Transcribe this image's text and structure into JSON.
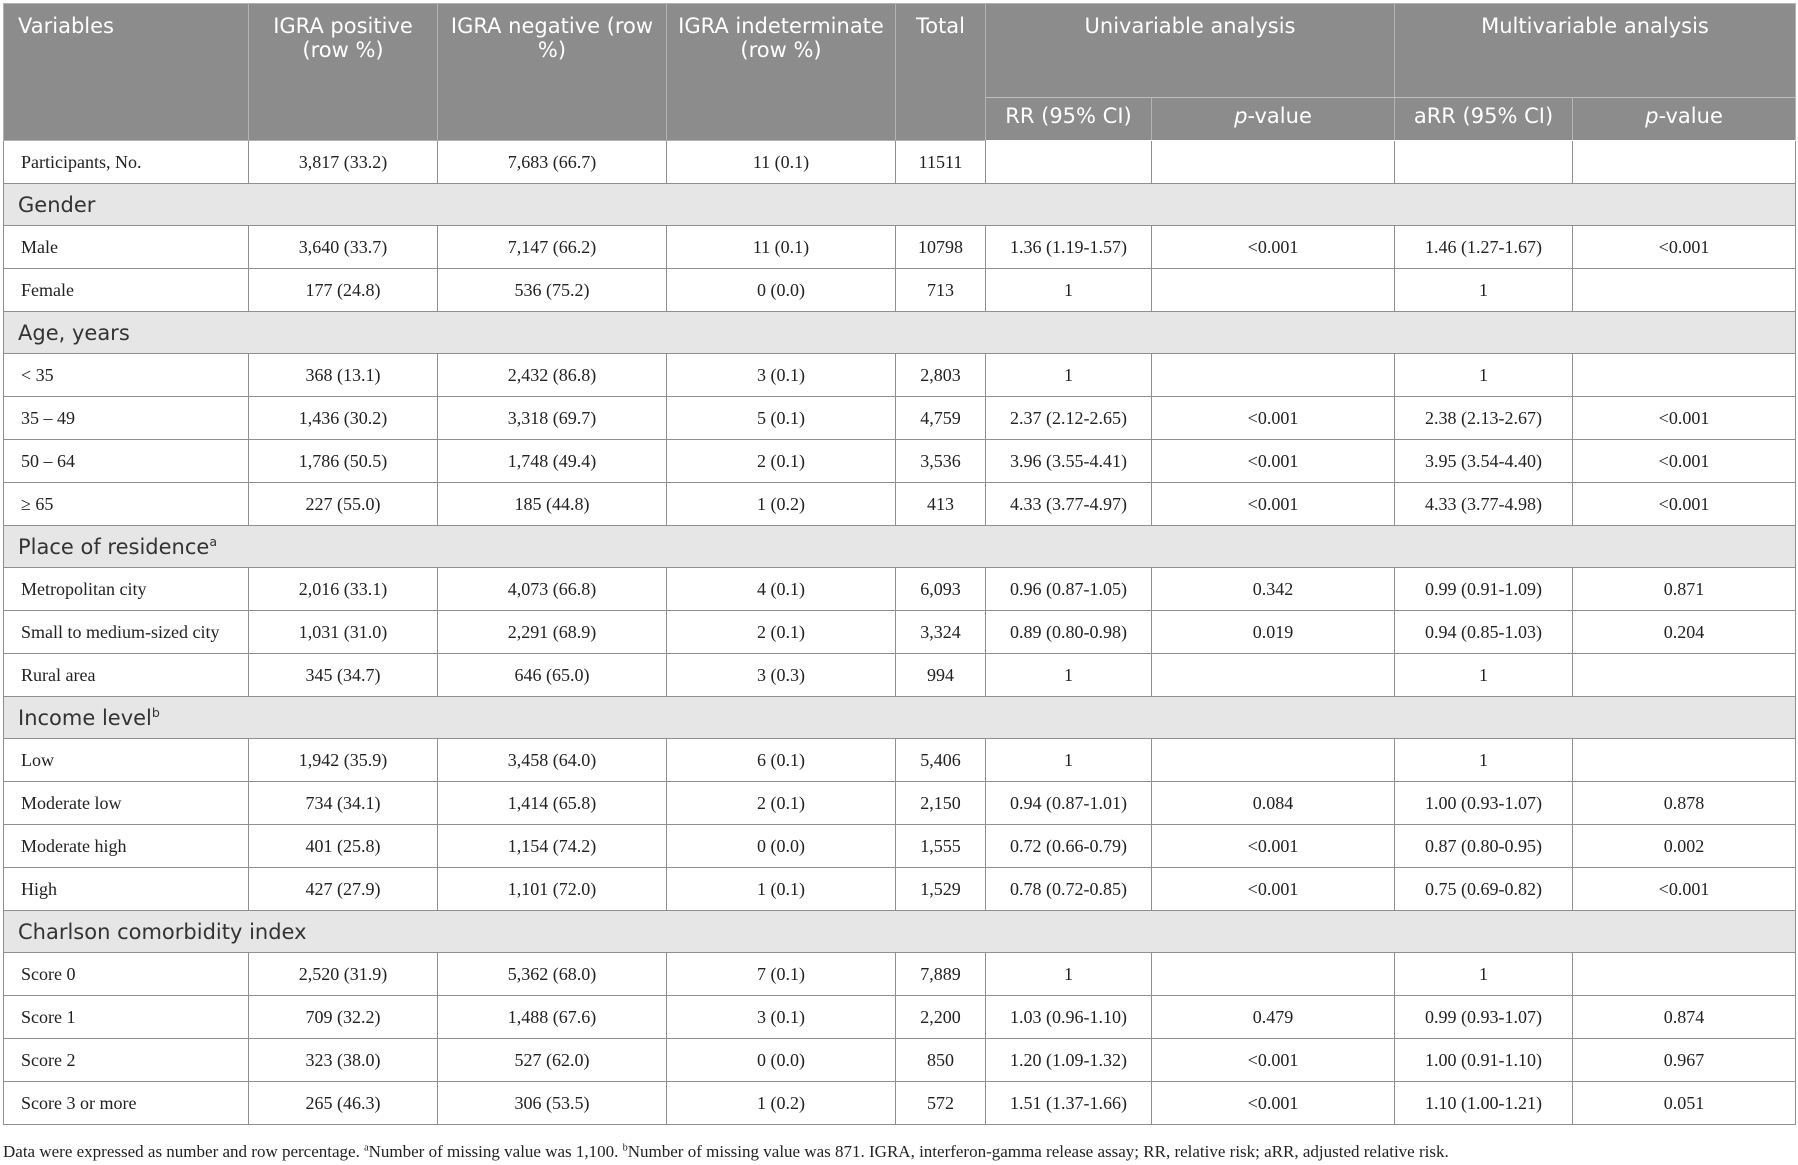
{
  "headers": {
    "variables": "Variables",
    "igra_positive": "IGRA positive (row %)",
    "igra_negative": "IGRA negative (row %)",
    "igra_indeterminate": "IGRA indeterminate (row %)",
    "total": "Total",
    "univariable": "Univariable analysis",
    "multivariable": "Multivariable analysis",
    "rr": "RR (95% CI)",
    "pvalue_p": "p",
    "pvalue_rest": "-value",
    "arr": "aRR (95% CI)"
  },
  "participants": {
    "label": "Participants, No.",
    "pos": "3,817 (33.2)",
    "neg": "7,683 (66.7)",
    "ind": "11 (0.1)",
    "total": "11511"
  },
  "sections": [
    {
      "title": "Gender",
      "sup": "",
      "rows": [
        {
          "label": "Male",
          "pos": "3,640 (33.7)",
          "neg": "7,147 (66.2)",
          "ind": "11 (0.1)",
          "total": "10798",
          "rr": "1.36 (1.19-1.57)",
          "p1": "<0.001",
          "arr": "1.46 (1.27-1.67)",
          "p2": "<0.001"
        },
        {
          "label": "Female",
          "pos": "177 (24.8)",
          "neg": "536 (75.2)",
          "ind": "0 (0.0)",
          "total": "713",
          "rr": "1",
          "p1": "",
          "arr": "1",
          "p2": ""
        }
      ]
    },
    {
      "title": "Age, years",
      "sup": "",
      "rows": [
        {
          "label": "< 35",
          "pos": "368 (13.1)",
          "neg": "2,432 (86.8)",
          "ind": "3 (0.1)",
          "total": "2,803",
          "rr": "1",
          "p1": "",
          "arr": "1",
          "p2": ""
        },
        {
          "label": "35 – 49",
          "pos": "1,436 (30.2)",
          "neg": "3,318 (69.7)",
          "ind": "5 (0.1)",
          "total": "4,759",
          "rr": "2.37 (2.12-2.65)",
          "p1": "<0.001",
          "arr": "2.38 (2.13-2.67)",
          "p2": "<0.001"
        },
        {
          "label": "50 – 64",
          "pos": "1,786 (50.5)",
          "neg": "1,748 (49.4)",
          "ind": "2 (0.1)",
          "total": "3,536",
          "rr": "3.96 (3.55-4.41)",
          "p1": "<0.001",
          "arr": "3.95 (3.54-4.40)",
          "p2": "<0.001"
        },
        {
          "label": "≥ 65",
          "pos": "227 (55.0)",
          "neg": "185 (44.8)",
          "ind": "1 (0.2)",
          "total": "413",
          "rr": "4.33 (3.77-4.97)",
          "p1": "<0.001",
          "arr": "4.33 (3.77-4.98)",
          "p2": "<0.001"
        }
      ]
    },
    {
      "title": "Place of residence",
      "sup": "a",
      "rows": [
        {
          "label": "Metropolitan city",
          "pos": "2,016 (33.1)",
          "neg": "4,073 (66.8)",
          "ind": "4 (0.1)",
          "total": "6,093",
          "rr": "0.96 (0.87-1.05)",
          "p1": "0.342",
          "arr": "0.99 (0.91-1.09)",
          "p2": "0.871"
        },
        {
          "label": "Small to medium-sized city",
          "pos": "1,031 (31.0)",
          "neg": "2,291 (68.9)",
          "ind": "2 (0.1)",
          "total": "3,324",
          "rr": "0.89 (0.80-0.98)",
          "p1": "0.019",
          "arr": "0.94 (0.85-1.03)",
          "p2": "0.204"
        },
        {
          "label": "Rural area",
          "pos": "345 (34.7)",
          "neg": "646 (65.0)",
          "ind": "3 (0.3)",
          "total": "994",
          "rr": "1",
          "p1": "",
          "arr": "1",
          "p2": ""
        }
      ]
    },
    {
      "title": "Income level",
      "sup": "b",
      "rows": [
        {
          "label": "Low",
          "pos": "1,942 (35.9)",
          "neg": "3,458 (64.0)",
          "ind": "6 (0.1)",
          "total": "5,406",
          "rr": "1",
          "p1": "",
          "arr": "1",
          "p2": ""
        },
        {
          "label": "Moderate low",
          "pos": "734 (34.1)",
          "neg": "1,414 (65.8)",
          "ind": "2 (0.1)",
          "total": "2,150",
          "rr": "0.94 (0.87-1.01)",
          "p1": "0.084",
          "arr": "1.00 (0.93-1.07)",
          "p2": "0.878"
        },
        {
          "label": "Moderate high",
          "pos": "401 (25.8)",
          "neg": "1,154 (74.2)",
          "ind": "0 (0.0)",
          "total": "1,555",
          "rr": "0.72 (0.66-0.79)",
          "p1": "<0.001",
          "arr": "0.87 (0.80-0.95)",
          "p2": "0.002"
        },
        {
          "label": "High",
          "pos": "427 (27.9)",
          "neg": "1,101 (72.0)",
          "ind": "1 (0.1)",
          "total": "1,529",
          "rr": "0.78 (0.72-0.85)",
          "p1": "<0.001",
          "arr": "0.75 (0.69-0.82)",
          "p2": "<0.001"
        }
      ]
    },
    {
      "title": "Charlson comorbidity index",
      "sup": "",
      "rows": [
        {
          "label": "Score 0",
          "pos": "2,520 (31.9)",
          "neg": "5,362 (68.0)",
          "ind": "7 (0.1)",
          "total": "7,889",
          "rr": "1",
          "p1": "",
          "arr": "1",
          "p2": ""
        },
        {
          "label": "Score 1",
          "pos": "709 (32.2)",
          "neg": "1,488 (67.6)",
          "ind": "3 (0.1)",
          "total": "2,200",
          "rr": "1.03 (0.96-1.10)",
          "p1": "0.479",
          "arr": "0.99 (0.93-1.07)",
          "p2": "0.874"
        },
        {
          "label": "Score 2",
          "pos": "323 (38.0)",
          "neg": "527 (62.0)",
          "ind": "0 (0.0)",
          "total": "850",
          "rr": "1.20 (1.09-1.32)",
          "p1": "<0.001",
          "arr": "1.00 (0.91-1.10)",
          "p2": "0.967"
        },
        {
          "label": "Score 3 or more",
          "pos": "265 (46.3)",
          "neg": "306 (53.5)",
          "ind": "1 (0.2)",
          "total": "572",
          "rr": "1.51 (1.37-1.66)",
          "p1": "<0.001",
          "arr": "1.10 (1.00-1.21)",
          "p2": "0.051"
        }
      ]
    }
  ],
  "footnote": {
    "part1": "Data were expressed as number and row percentage. ",
    "sup_a": "a",
    "part2": "Number of missing value was 1,100. ",
    "sup_b": "b",
    "part3": "Number of missing value was 871. IGRA, interferon-gamma release assay; RR, relative risk; aRR, adjusted relative risk."
  }
}
